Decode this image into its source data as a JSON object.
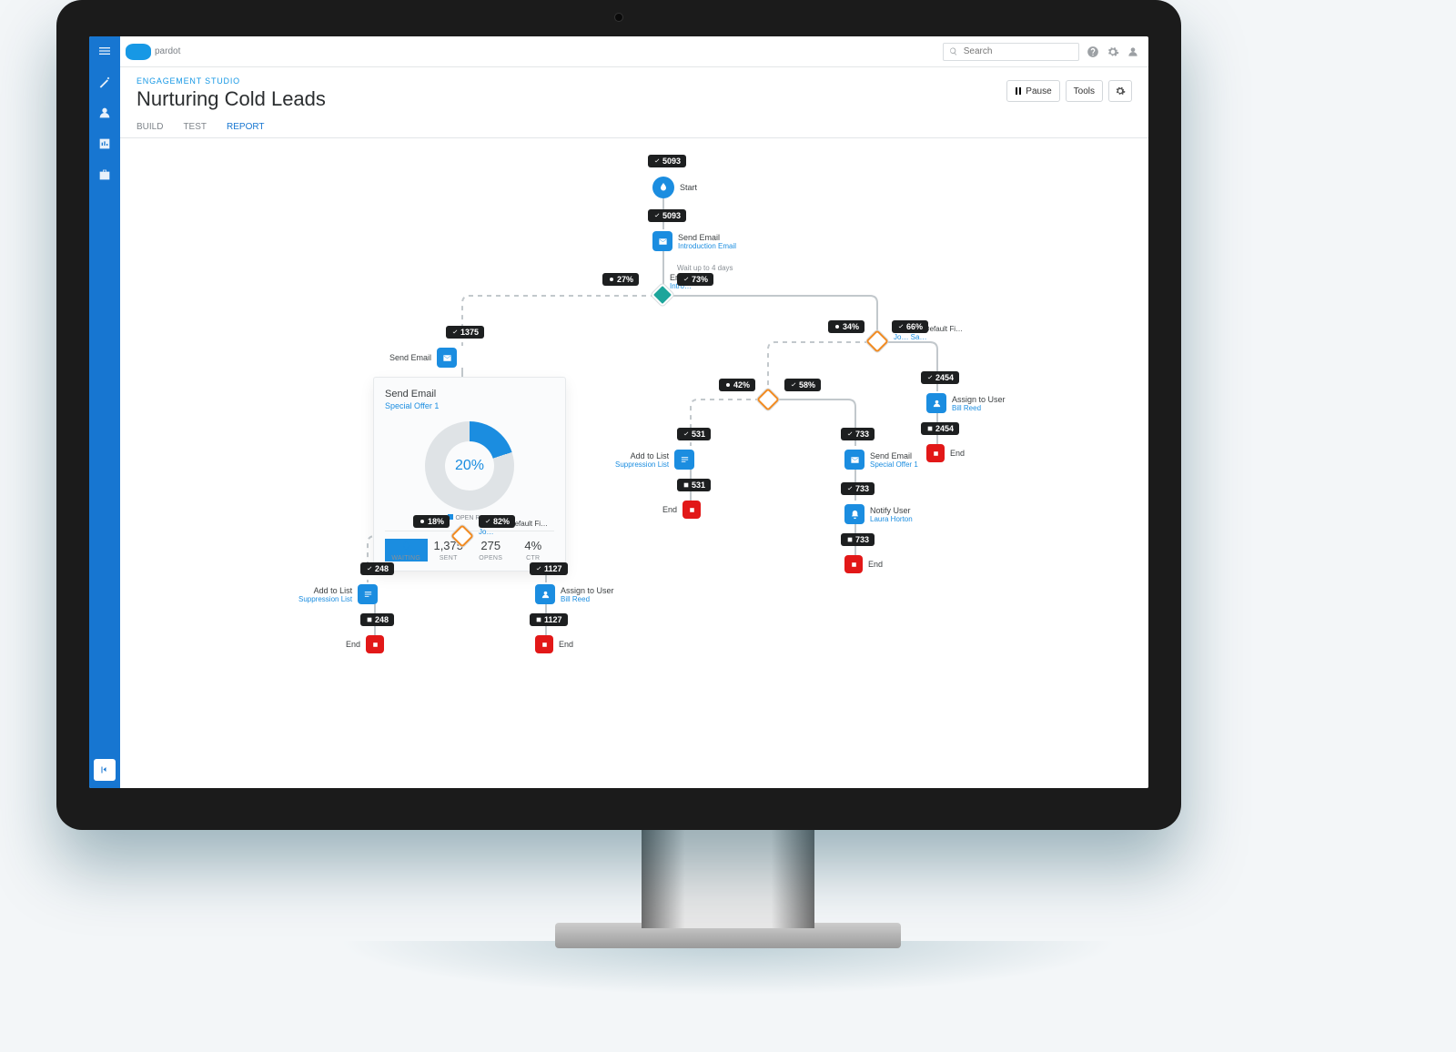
{
  "brand": {
    "logo_text": "pardot"
  },
  "topbar": {
    "search_placeholder": "Search"
  },
  "header": {
    "breadcrumb": "ENGAGEMENT STUDIO",
    "title": "Nurturing Cold Leads"
  },
  "actions": {
    "pause": "Pause",
    "tools": "Tools"
  },
  "tabs": [
    "BUILD",
    "TEST",
    "REPORT"
  ],
  "active_tab_index": 2,
  "chart_data": {
    "type": "pie",
    "title": "Send Email — Special Offer 1",
    "series": [
      {
        "name": "OPEN RATE",
        "values": [
          20,
          80
        ]
      }
    ],
    "center_label": "20%",
    "legend": "OPEN RATE",
    "stats": [
      {
        "value": "0",
        "label": "WAITING"
      },
      {
        "value": "1,375",
        "label": "SENT"
      },
      {
        "value": "275",
        "label": "OPENS"
      },
      {
        "value": "4%",
        "label": "CTR"
      }
    ]
  },
  "detail": {
    "title": "Send Email",
    "subtitle": "Special Offer 1"
  },
  "nodes": {
    "start": {
      "label": "Start",
      "count": "5093"
    },
    "n1": {
      "label": "Send Email",
      "sub": "Introduction Email",
      "count": "5093"
    },
    "wait1": {
      "label": "Wait up to 4 days"
    },
    "trig1": {
      "label": "Ema…",
      "sub": "Intro…",
      "no": "27%",
      "yes": "73%"
    },
    "n2": {
      "label": "Send Email",
      "sub": "Special Offer 1",
      "count": "1375"
    },
    "trig2": {
      "label": "Prospect Default Fi…",
      "sub": "Jo…",
      "no": "18%",
      "yes": "82%"
    },
    "n2a": {
      "label": "Add to List",
      "sub": "Suppression List",
      "count": "248"
    },
    "end2a": {
      "label": "End",
      "count": "248"
    },
    "n2b": {
      "label": "Assign to User",
      "sub": "Bill Reed",
      "count": "1127"
    },
    "end2b": {
      "label": "End",
      "count": "1127"
    },
    "trig3": {
      "label": "Prospect Default Fi…",
      "sub": "Jo… Sa…",
      "no": "34%",
      "yes": "66%"
    },
    "r3b": {
      "label": "Assign to User",
      "sub": "Bill Reed",
      "count": "2454"
    },
    "end3b": {
      "label": "End",
      "count": "2454"
    },
    "rule4": {
      "no": "42%",
      "yes": "58%"
    },
    "n4a": {
      "label": "Add to List",
      "sub": "Suppression List",
      "count": "531"
    },
    "end4a": {
      "label": "End",
      "count": "531"
    },
    "n4b": {
      "label": "Send Email",
      "sub": "Special Offer 1",
      "count": "733"
    },
    "n4c": {
      "label": "Notify User",
      "sub": "Laura Horton",
      "count": "733"
    },
    "end4c": {
      "label": "End",
      "count": "733"
    }
  }
}
